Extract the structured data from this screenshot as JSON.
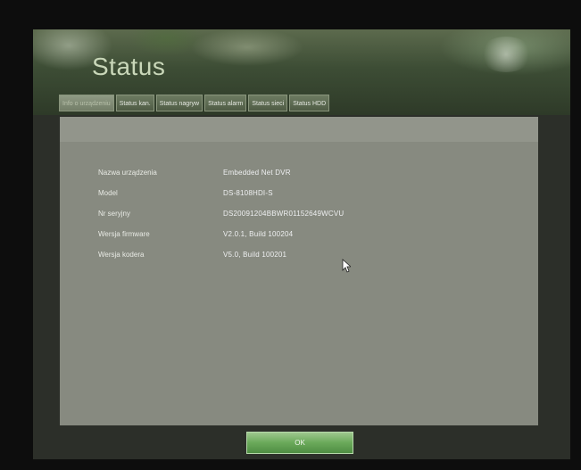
{
  "title": "Status",
  "tabs": [
    {
      "label": "Info o urządzeniu",
      "active": true
    },
    {
      "label": "Status kan.",
      "active": false
    },
    {
      "label": "Status nagryw",
      "active": false
    },
    {
      "label": "Status alarm",
      "active": false
    },
    {
      "label": "Status sieci",
      "active": false
    },
    {
      "label": "Status HDD",
      "active": false
    }
  ],
  "info": [
    {
      "label": "Nazwa urządzenia",
      "value": "Embedded Net DVR"
    },
    {
      "label": "Model",
      "value": "DS-8108HDI-S"
    },
    {
      "label": "Nr seryjny",
      "value": "DS20091204BBWR01152649WCVU"
    },
    {
      "label": "Wersja firmware",
      "value": "V2.0.1, Build 100204"
    },
    {
      "label": "Wersja kodera",
      "value": "V5.0, Build 100201"
    }
  ],
  "ok_label": "OK",
  "colors": {
    "panel": "#878a80",
    "ok_button": "#6aa95a",
    "title": "#c9d7b9"
  }
}
